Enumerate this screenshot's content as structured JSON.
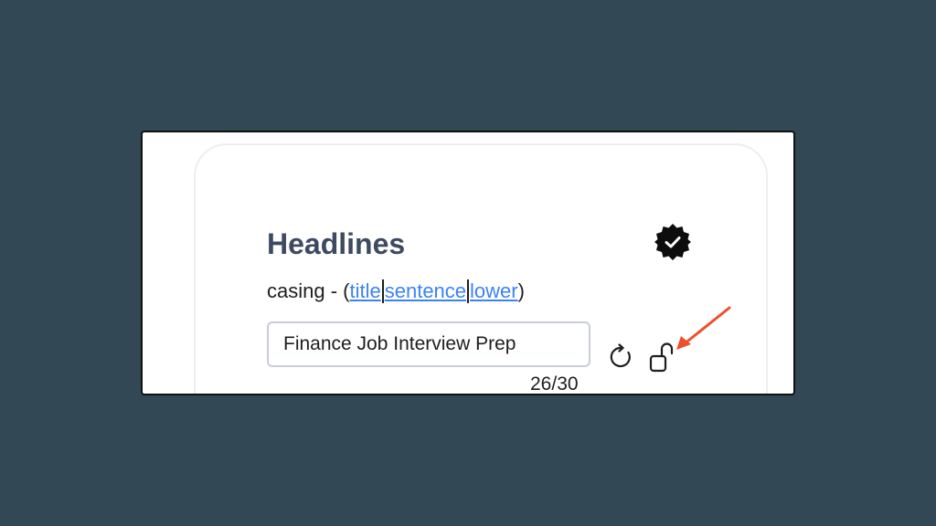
{
  "headlines": {
    "title": "Headlines",
    "casing_prefix": "casing - (",
    "casing_options": [
      "title",
      "sentence",
      "lower"
    ],
    "casing_suffix": ")",
    "input_value": "Finance Job Interview Prep",
    "char_count": "26/30"
  },
  "icons": {
    "verified": "verified-badge-icon",
    "refresh": "refresh-icon",
    "lock": "unlock-icon",
    "annotation": "red-arrow"
  },
  "colors": {
    "background": "#324854",
    "title": "#3d4a61",
    "link": "#3b82f6",
    "arrow": "#ef4f2c"
  }
}
